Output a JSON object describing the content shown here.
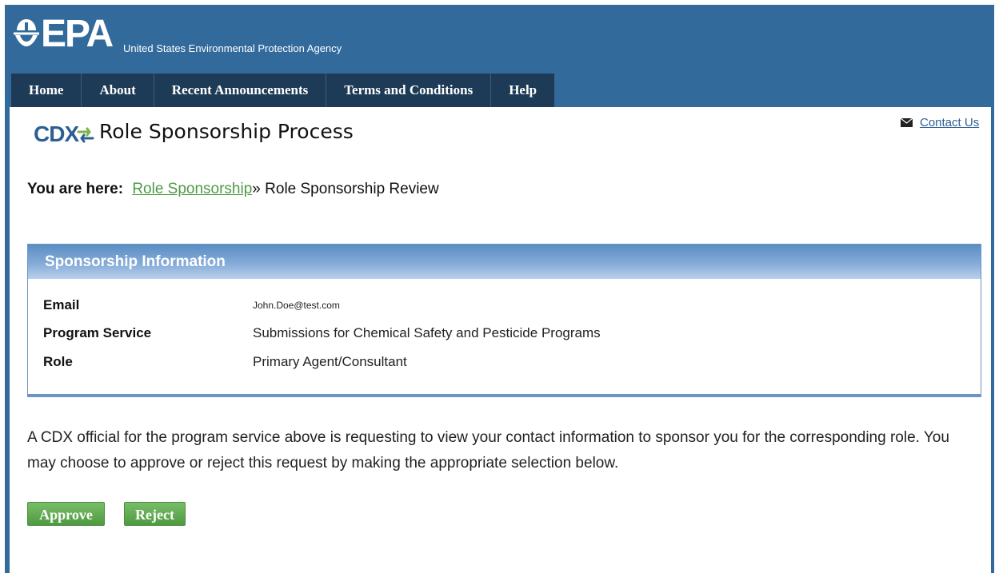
{
  "header": {
    "logo_text": "EPA",
    "agency_name": "United States Environmental Protection Agency"
  },
  "nav": {
    "items": [
      {
        "label": "Home"
      },
      {
        "label": "About"
      },
      {
        "label": "Recent Announcements"
      },
      {
        "label": "Terms and Conditions"
      },
      {
        "label": "Help"
      }
    ]
  },
  "page": {
    "cdx_logo_text": "CDX",
    "title": "Role Sponsorship Process",
    "contact_label": "Contact Us"
  },
  "breadcrumb": {
    "label": "You are here:",
    "link": "Role Sponsorship",
    "separator": "»",
    "current": "Role Sponsorship Review"
  },
  "panel": {
    "title": "Sponsorship Information",
    "rows": [
      {
        "label": "Email",
        "value": "John.Doe@test.com"
      },
      {
        "label": "Program Service",
        "value": "Submissions for Chemical Safety and Pesticide Programs"
      },
      {
        "label": "Role",
        "value": "Primary Agent/Consultant"
      }
    ]
  },
  "message": "A CDX official for the program service above is requesting to view your contact information to sponsor you for the corresponding role. You may choose to approve or reject this request by making the appropriate selection below.",
  "actions": {
    "approve_label": "Approve",
    "reject_label": "Reject"
  },
  "colors": {
    "header_blue": "#336a9c",
    "nav_dark": "#1d3b56",
    "link_green": "#4f9a45",
    "button_green": "#5fa94f"
  }
}
